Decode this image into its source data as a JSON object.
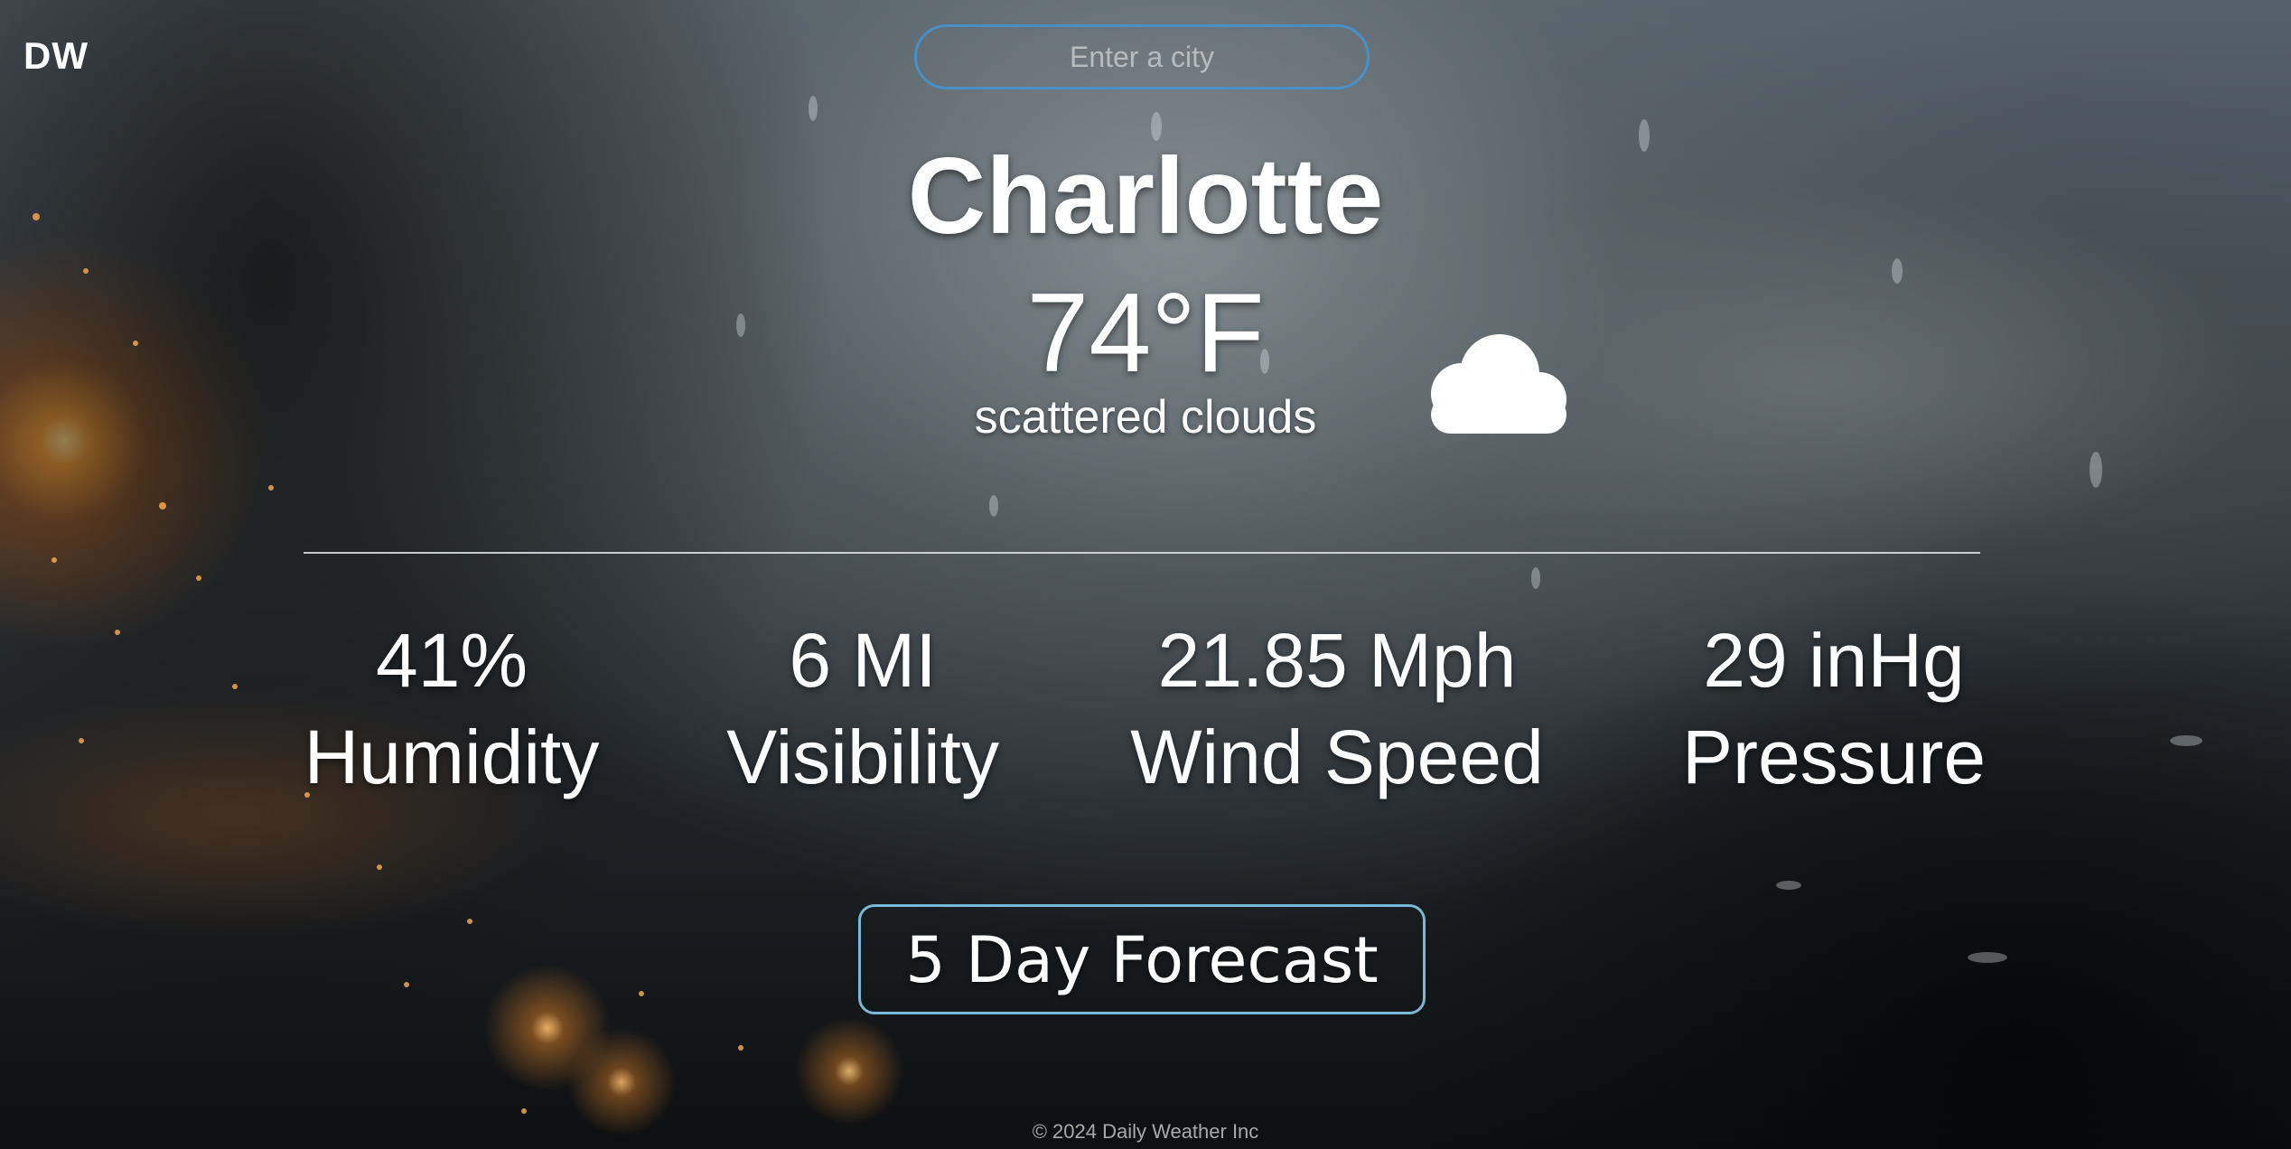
{
  "header": {
    "logo": "DW"
  },
  "search": {
    "placeholder": "Enter a city",
    "value": ""
  },
  "weather": {
    "city": "Charlotte",
    "temperature": "74°F",
    "description": "scattered clouds",
    "icon": "cloud-icon"
  },
  "stats": [
    {
      "value": "41%",
      "label": "Humidity"
    },
    {
      "value": "6 MI",
      "label": "Visibility"
    },
    {
      "value": "21.85 Mph",
      "label": "Wind Speed"
    },
    {
      "value": "29 inHg",
      "label": "Pressure"
    }
  ],
  "forecast_button": {
    "label": "5 Day Forecast"
  },
  "footer": {
    "copyright": "© 2024 Daily Weather Inc"
  },
  "colors": {
    "search_border": "#4a90c8",
    "button_border": "#7ab8d8",
    "text": "#ffffff",
    "footer_text": "#a9a9a9"
  }
}
